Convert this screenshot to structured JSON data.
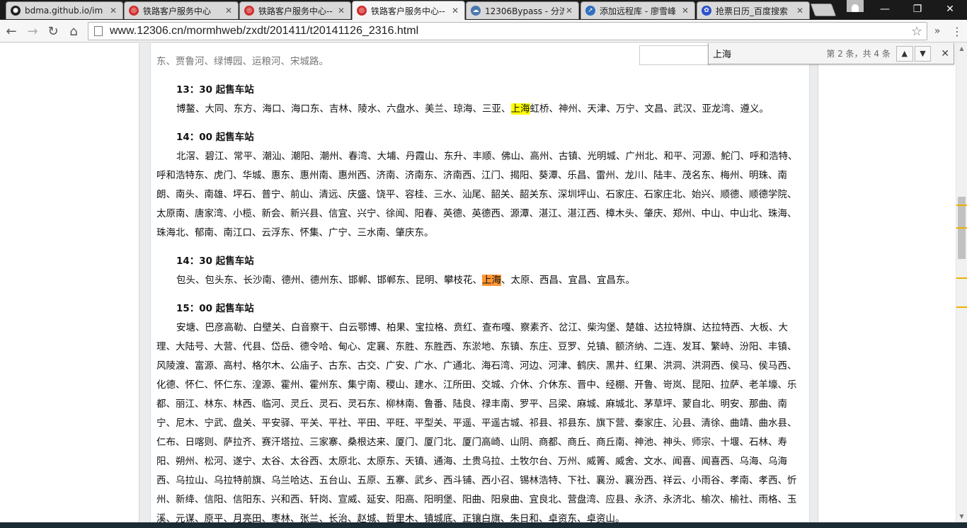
{
  "browser": {
    "tabs": [
      {
        "title": "bdma.github.io/im",
        "icon": "github-icon",
        "color": "#222222"
      },
      {
        "title": "铁路客户服务中心",
        "icon": "12306-icon",
        "color": "#d03030"
      },
      {
        "title": "铁路客户服务中心--",
        "icon": "12306-icon",
        "color": "#d03030"
      },
      {
        "title": "铁路客户服务中心--",
        "icon": "12306-icon",
        "color": "#d03030",
        "active": true
      },
      {
        "title": "12306Bypass - 分流",
        "icon": "cloud-icon",
        "color": "#4a78b0"
      },
      {
        "title": "添加远程库 - 廖雪峰",
        "icon": "rocket-icon",
        "color": "#3070c0"
      },
      {
        "title": "抢票日历_百度搜索",
        "icon": "baidu-icon",
        "color": "#2a50d0"
      }
    ],
    "url": "www.12306.cn/mormhweb/zxdt/201411/t20141126_2316.html",
    "window_controls": {
      "minimize": "—",
      "maximize": "❐",
      "close": "✕"
    },
    "menu_glyph": "»",
    "more_glyph": "⋮"
  },
  "find": {
    "query": "上海",
    "count_text": "第 2 条，共 4 条",
    "prev_glyph": "▲",
    "next_glyph": "▼",
    "close_glyph": "✕"
  },
  "article": {
    "top_partial": "东、贾鲁河、绿博园、运粮河、宋城路。",
    "sections": [
      {
        "title": "13：30 起售车站",
        "pre": "博鳌、大同、东方、海口、海口东、吉林、陵水、六盘水、美兰、琼海、三亚、",
        "hl": "上海",
        "hl_current": false,
        "post": "虹桥、神州、天津、万宁、文昌、武汉、亚龙湾、遵义。"
      },
      {
        "title": "14：00 起售车站",
        "pre": "北滘、碧江、常平、潮汕、潮阳、潮州、春湾、大埔、丹霞山、东升、丰顺、佛山、高州、古镇、光明城、广州北、和平、河源、鮀门、呼和浩特、呼和浩特东、虎门、华城、惠东、惠州南、惠州西、济南、济南东、济南西、江门、揭阳、葵潭、乐昌、雷州、龙川、陆丰、茂名东、梅州、明珠、南朗、南头、南雄、坪石、普宁、前山、清远、庆盛、饶平、容桂、三水、汕尾、韶关、韶关东、深圳坪山、石家庄、石家庄北、始兴、顺德、顺德学院、太原南、唐家湾、小榄、新会、新兴县、信宜、兴宁、徐闻、阳春、英德、英德西、源潭、湛江、湛江西、樟木头、肇庆、郑州、中山、中山北、珠海、珠海北、郁南、南江口、云浮东、怀集、广宁、三水南、肇庆东。",
        "hl": "",
        "hl_current": false,
        "post": ""
      },
      {
        "title": "14：30 起售车站",
        "pre": "包头、包头东、长沙南、德州、德州东、邯郸、邯郸东、昆明、攀枝花、",
        "hl": "上海",
        "hl_current": true,
        "post": "、太原、西昌、宜昌、宜昌东。"
      },
      {
        "title": "15：00 起售车站",
        "pre": "安塘、巴彦高勒、白壁关、白音察干、白云鄂博、柏果、宝拉格、贲红、查布嘎、察素齐、岔江、柴沟堡、楚雄、达拉特旗、达拉特西、大板、大理、大陆号、大营、代县、岱岳、德令哈、甸心、定襄、东胜、东胜西、东淤地、东镇、东庄、豆罗、兑镇、额济纳、二连、发耳、繁峙、汾阳、丰镇、风陵渡、富源、高村、格尔木、公庙子、古东、古交、广安、广水、广通北、海石湾、河边、河津、鹤庆、黑井、红果、洪洞、洪洞西、侯马、侯马西、化德、怀仁、怀仁东、湟源、霍州、霍州东、集宁南、稷山、建水、江所田、交城、介休、介休东、晋中、经棚、开鲁、岢岚、昆阳、拉萨、老羊壕、乐都、丽江、林东、林西、临河、灵丘、灵石、灵石东、柳林南、鲁番、陆良、禄丰南、罗平、吕梁、麻城、麻城北、茅草坪、蒙自北、明安、那曲、南宁、尼木、宁武、盘关、平安驿、平关、平社、平田、平旺、平型关、平遥、平遥古城、祁县、祁县东、旗下营、秦家庄、沁县、清徐、曲靖、曲水县、仁布、日喀则、萨拉齐、赛汗塔拉、三家寨、桑根达来、厦门、厦门北、厦门高崎、山阴、商都、商丘、商丘南、神池、神头、师宗、十堰、石林、寿阳、朔州、松河、遂宁、太谷、太谷西、太原北、太原东、天镇、通海、土贵乌拉、土牧尔台、万州、威箐、威舍、文水、闻喜、闻喜西、乌海、乌海西、乌拉山、乌拉特前旗、乌兰哈达、五台山、五原、五寨、武乡、西斗铺、西小召、锡林浩特、下社、襄汾、襄汾西、祥云、小雨谷、孝南、孝西、忻州、新绛、信阳、信阳东、兴和西、轩岗、宣威、延安、阳高、阳明堡、阳曲、阳泉曲、宜良北、营盘湾、应县、永济、永济北、榆次、榆社、雨格、玉溪、元谋、原平、月亮田、枣林、张兰、长治、赵城、哲里木、镇城底、正镶白旗、朱日和、卓资东、卓资山。",
        "hl": "",
        "hl_current": false,
        "post": ""
      }
    ]
  },
  "colors": {
    "highlight": "#ffff00",
    "highlight_current": "#ff9632",
    "scroll_marks": "#f0b000"
  }
}
